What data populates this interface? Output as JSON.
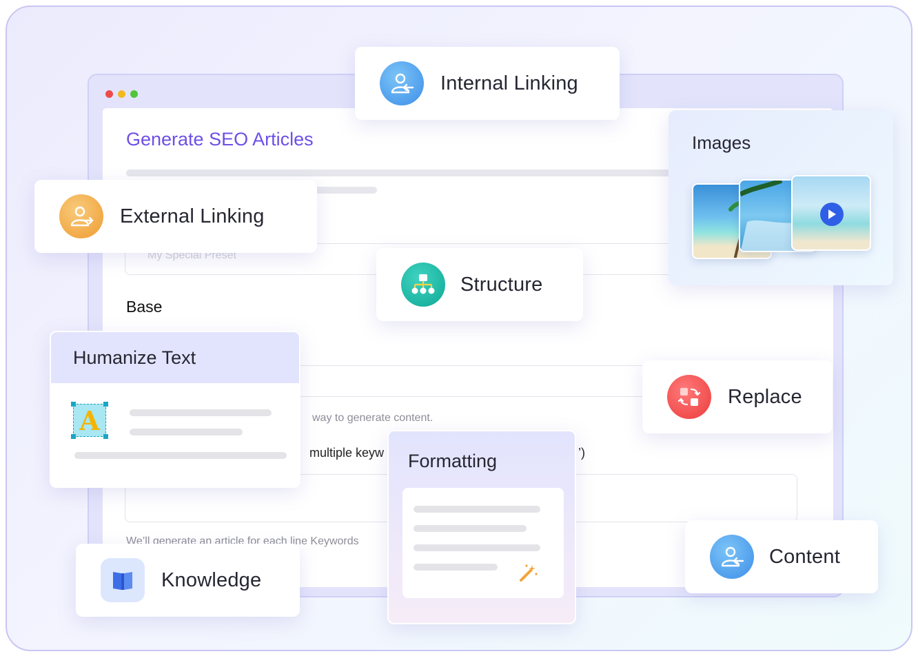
{
  "form": {
    "title": "Generate SEO Articles",
    "preset_placeholder": "My Special Preset",
    "section_base": "Base",
    "hint_generate": "way to generate content.",
    "keywords_label": "multiple keyw",
    "keywords_label_end": "’)",
    "hint_keywords": "We’ll generate an article for each line Keywords"
  },
  "features": {
    "internal_linking": "Internal Linking",
    "external_linking": "External Linking",
    "structure": "Structure",
    "images": "Images",
    "humanize_text": "Humanize Text",
    "humanize_glyph": "A",
    "replace": "Replace",
    "formatting": "Formatting",
    "content": "Content",
    "knowledge": "Knowledge"
  },
  "colors": {
    "accent_purple": "#6e4fe6",
    "dot_red": "#ee4b4b",
    "dot_yellow": "#f3b81f",
    "dot_green": "#4fc53a",
    "icon_blue": "#3d8ee8",
    "icon_orange": "#f2a43a",
    "icon_teal": "#14b8a6",
    "icon_red": "#ef4444"
  },
  "icons": {
    "internal_linking": "user-arrow-left-icon",
    "external_linking": "user-arrow-right-icon",
    "structure": "sitemap-icon",
    "replace": "swap-icon",
    "content": "user-arrow-left-icon",
    "knowledge": "book-icon",
    "formatting": "magic-wand-icon",
    "images_play": "play-icon"
  }
}
